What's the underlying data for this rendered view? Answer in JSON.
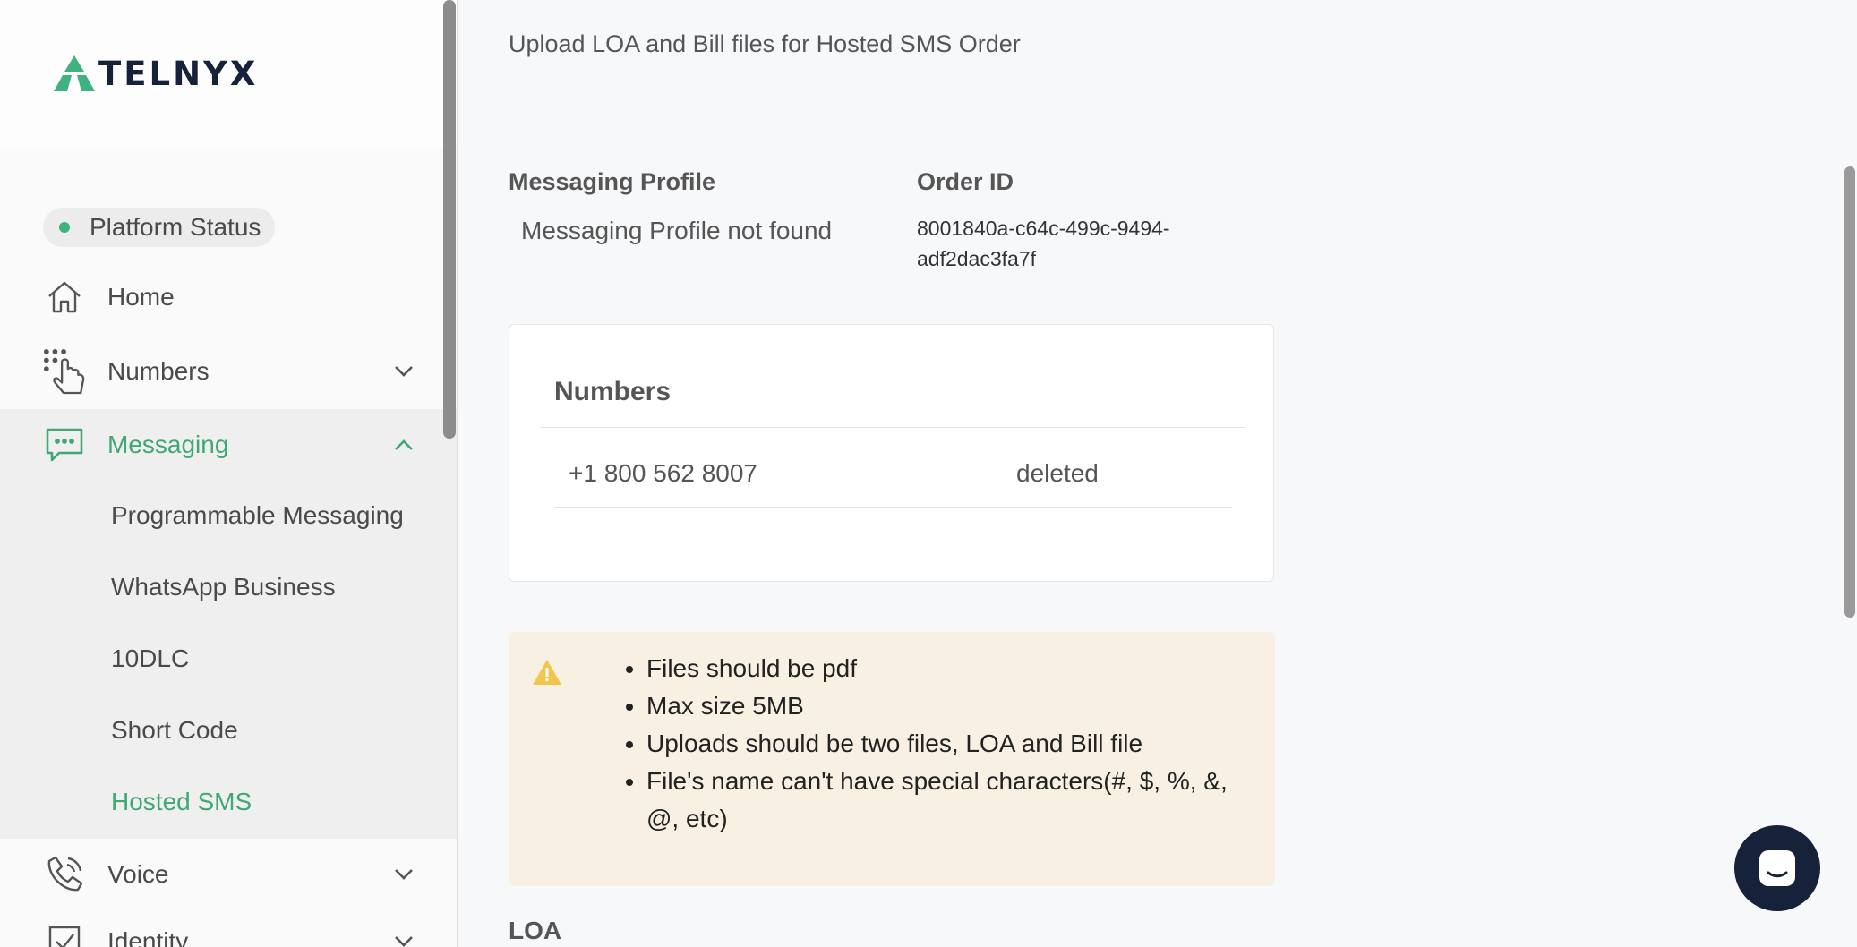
{
  "brand": {
    "name": "TELNYX",
    "accent": "#3fa874",
    "dark": "#16213a"
  },
  "sidebar": {
    "status": {
      "label": "Platform Status",
      "color": "#3fb37f"
    },
    "items": [
      {
        "label": "Home",
        "icon": "home-icon"
      },
      {
        "label": "Numbers",
        "icon": "dialpad-hand-icon"
      },
      {
        "label": "Messaging",
        "icon": "chat-icon",
        "active": true
      },
      {
        "label": "Voice",
        "icon": "phone-icon"
      },
      {
        "label": "Identity",
        "icon": "check-box-icon"
      }
    ],
    "messaging_sub": [
      {
        "label": "Programmable Messaging"
      },
      {
        "label": "WhatsApp Business"
      },
      {
        "label": "10DLC"
      },
      {
        "label": "Short Code"
      },
      {
        "label": "Hosted SMS",
        "active": true
      }
    ]
  },
  "main": {
    "subtitle": "Upload LOA and Bill files for Hosted SMS Order",
    "messaging_profile": {
      "label": "Messaging Profile",
      "value": "Messaging Profile not found"
    },
    "order": {
      "label": "Order ID",
      "value": "8001840a-c64c-499c-9494-adf2dac3fa7f"
    },
    "numbers_card": {
      "title": "Numbers",
      "rows": [
        {
          "number": "+1 800 562 8007",
          "status": "deleted"
        }
      ]
    },
    "notice": {
      "items": [
        "Files should be pdf",
        "Max size 5MB",
        "Uploads should be two files, LOA and Bill file",
        "File's name can't have special characters(#, $, %, &, @, etc)"
      ]
    },
    "loa_label": "LOA"
  }
}
